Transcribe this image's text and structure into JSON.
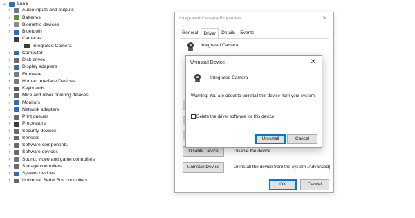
{
  "tree": {
    "root": "Luna",
    "items": [
      {
        "label": "Audio inputs and outputs",
        "icon": "speaker-icon",
        "color": "#6b7a8a",
        "expanded": false
      },
      {
        "label": "Batteries",
        "icon": "battery-icon",
        "color": "#4a9a3b",
        "expanded": false
      },
      {
        "label": "Biometric devices",
        "icon": "fingerprint-icon",
        "color": "#8a8a8a",
        "expanded": false
      },
      {
        "label": "Bluetooth",
        "icon": "bluetooth-icon",
        "color": "#1f6fd0",
        "expanded": false
      },
      {
        "label": "Cameras",
        "icon": "camera-icon",
        "color": "#3b3b3b",
        "expanded": true
      },
      {
        "label": "Integrated Camera",
        "icon": "camera-icon",
        "color": "#3b3b3b",
        "child": true
      },
      {
        "label": "Computer",
        "icon": "computer-icon",
        "color": "#2d6fb8",
        "expanded": false
      },
      {
        "label": "Disk drives",
        "icon": "disk-icon",
        "color": "#6a6a6a",
        "expanded": false
      },
      {
        "label": "Display adapters",
        "icon": "display-icon",
        "color": "#2d6fb8",
        "expanded": false
      },
      {
        "label": "Firmware",
        "icon": "firmware-icon",
        "color": "#7a7a7a",
        "expanded": false
      },
      {
        "label": "Human Interface Devices",
        "icon": "hid-icon",
        "color": "#7a7a7a",
        "expanded": false
      },
      {
        "label": "Keyboards",
        "icon": "keyboard-icon",
        "color": "#5a5a5a",
        "expanded": false
      },
      {
        "label": "Mice and other pointing devices",
        "icon": "mouse-icon",
        "color": "#6a6a6a",
        "expanded": false
      },
      {
        "label": "Monitors",
        "icon": "monitor-icon",
        "color": "#2d6fb8",
        "expanded": false
      },
      {
        "label": "Network adapters",
        "icon": "network-icon",
        "color": "#2d6fb8",
        "expanded": false
      },
      {
        "label": "Print queues",
        "icon": "printer-icon",
        "color": "#6a6a6a",
        "expanded": false
      },
      {
        "label": "Processors",
        "icon": "processor-icon",
        "color": "#3a3a3a",
        "expanded": false
      },
      {
        "label": "Security devices",
        "icon": "security-icon",
        "color": "#6a6a6a",
        "expanded": false
      },
      {
        "label": "Sensors",
        "icon": "sensor-icon",
        "color": "#6a6a6a",
        "expanded": false
      },
      {
        "label": "Software components",
        "icon": "component-icon",
        "color": "#6a6a6a",
        "expanded": false
      },
      {
        "label": "Software devices",
        "icon": "software-device-icon",
        "color": "#6a6a6a",
        "expanded": false
      },
      {
        "label": "Sound, video and game controllers",
        "icon": "sound-icon",
        "color": "#6b7a8a",
        "expanded": false
      },
      {
        "label": "Storage controllers",
        "icon": "storage-icon",
        "color": "#6a6a6a",
        "expanded": false
      },
      {
        "label": "System devices",
        "icon": "system-icon",
        "color": "#2d6fb8",
        "expanded": false
      },
      {
        "label": "Universal Serial Bus controllers",
        "icon": "usb-icon",
        "color": "#6a6a6a",
        "expanded": false
      }
    ]
  },
  "props": {
    "title": "Integrated Camera Properties",
    "tabs": [
      "General",
      "Driver",
      "Details",
      "Events"
    ],
    "active_tab": "Driver",
    "device_name": "Integrated Camera",
    "disable_button": "Disable Device",
    "disable_desc": "Disable the device.",
    "uninstall_button": "Uninstall Device",
    "uninstall_desc": "Uninstall the device from the system (Advanced).",
    "ok": "OK",
    "cancel": "Cancel"
  },
  "dialog": {
    "title": "Uninstall Device",
    "device_name": "Integrated Camera",
    "warning": "Warning: You are about to uninstall this device from your system.",
    "checkbox_label": "Delete the driver software for this device.",
    "checkbox_checked": false,
    "uninstall": "Uninstall",
    "cancel": "Cancel"
  }
}
